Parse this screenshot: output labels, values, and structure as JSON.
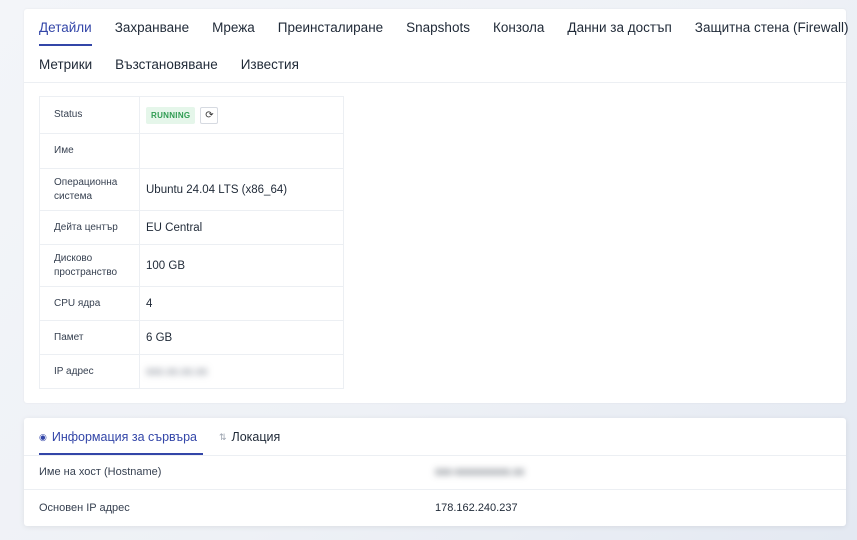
{
  "tabs_row1": [
    "Детайли",
    "Захранване",
    "Мрежа",
    "Преинсталиране",
    "Snapshots",
    "Конзола",
    "Данни за достъп",
    "Защитна стена (Firewall)"
  ],
  "tabs_row2": [
    "Метрики",
    "Възстановяване",
    "Известия"
  ],
  "active_tab": "Детайли",
  "details": {
    "status_label": "Status",
    "status_value": "RUNNING",
    "name_label": "Име",
    "name_value": "",
    "os_label": "Операционна система",
    "os_value": "Ubuntu 24.04 LTS (x86_64)",
    "dc_label": "Дейта център",
    "dc_value": "EU Central",
    "disk_label": "Дисково пространство",
    "disk_value": "100 GB",
    "cpu_label": "CPU ядра",
    "cpu_value": "4",
    "mem_label": "Памет",
    "mem_value": "6 GB",
    "ip_label": "IP адрес",
    "ip_value": "xxx.xx.xx.xx"
  },
  "info_tabs": {
    "server_info": "Информация за сървъра",
    "location": "Локация"
  },
  "info": {
    "hostname_label": "Име на хост (Hostname)",
    "hostname_value": "xxx-xxxxxxxxxx.xx",
    "primary_ip_label": "Основен IP адрес",
    "primary_ip_value": "178.162.240.237"
  },
  "colors": {
    "accent": "#3346a8",
    "running_bg": "#e5f6ea",
    "running_fg": "#2f9c52"
  }
}
